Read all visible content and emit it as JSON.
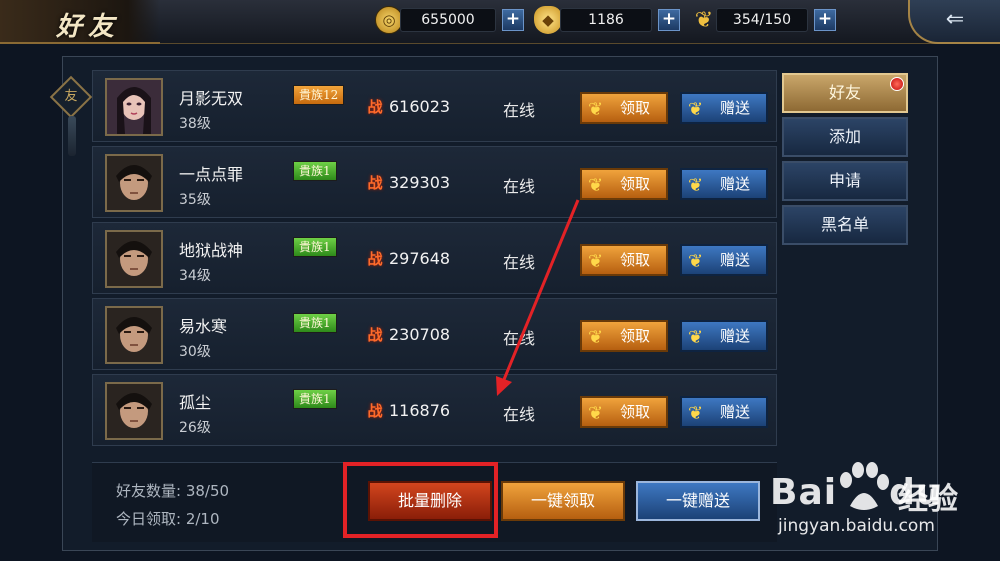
{
  "header": {
    "title": "好友",
    "resources": [
      {
        "icon": "gold-coin-icon",
        "value": "655000"
      },
      {
        "icon": "gold-ingot-icon",
        "value": "1186"
      },
      {
        "icon": "stamina-wheat-icon",
        "value": "354/150"
      }
    ],
    "plus_symbol": "+"
  },
  "ornament_char": "友",
  "friends": [
    {
      "name": "月影无双",
      "level": "38级",
      "vip": "貴族12",
      "vip_color": "orange",
      "power": "616023",
      "status": "在线",
      "claim": "领取",
      "give": "赠送"
    },
    {
      "name": "一点点罪",
      "level": "35级",
      "vip": "貴族1",
      "vip_color": "green",
      "power": "329303",
      "status": "在线",
      "claim": "领取",
      "give": "赠送"
    },
    {
      "name": "地狱战神",
      "level": "34级",
      "vip": "貴族1",
      "vip_color": "green",
      "power": "297648",
      "status": "在线",
      "claim": "领取",
      "give": "赠送"
    },
    {
      "name": "易水寒",
      "level": "30级",
      "vip": "貴族1",
      "vip_color": "green",
      "power": "230708",
      "status": "在线",
      "claim": "领取",
      "give": "赠送"
    },
    {
      "name": "孤尘",
      "level": "26级",
      "vip": "貴族1",
      "vip_color": "green",
      "power": "116876",
      "status": "在线",
      "claim": "领取",
      "give": "赠送"
    }
  ],
  "power_glyph": "战",
  "tabs": [
    {
      "label": "好友",
      "active": true,
      "badge": true
    },
    {
      "label": "添加",
      "active": false
    },
    {
      "label": "申请",
      "active": false
    },
    {
      "label": "黑名单",
      "active": false
    }
  ],
  "footer": {
    "friend_count": "好友数量: 38/50",
    "today_claimed": "今日领取: 2/10",
    "batch_delete": "批量删除",
    "claim_all": "一键领取",
    "give_all": "一键赠送"
  },
  "watermark": {
    "brand": "Bai",
    "brand2": "du",
    "cn": "经验",
    "url": "jingyan.baidu.com"
  },
  "colors": {
    "claim_button": "#e08a2a",
    "give_button": "#2e5c9a",
    "active_tab": "#b8925a",
    "highlight_box": "#e32226"
  }
}
